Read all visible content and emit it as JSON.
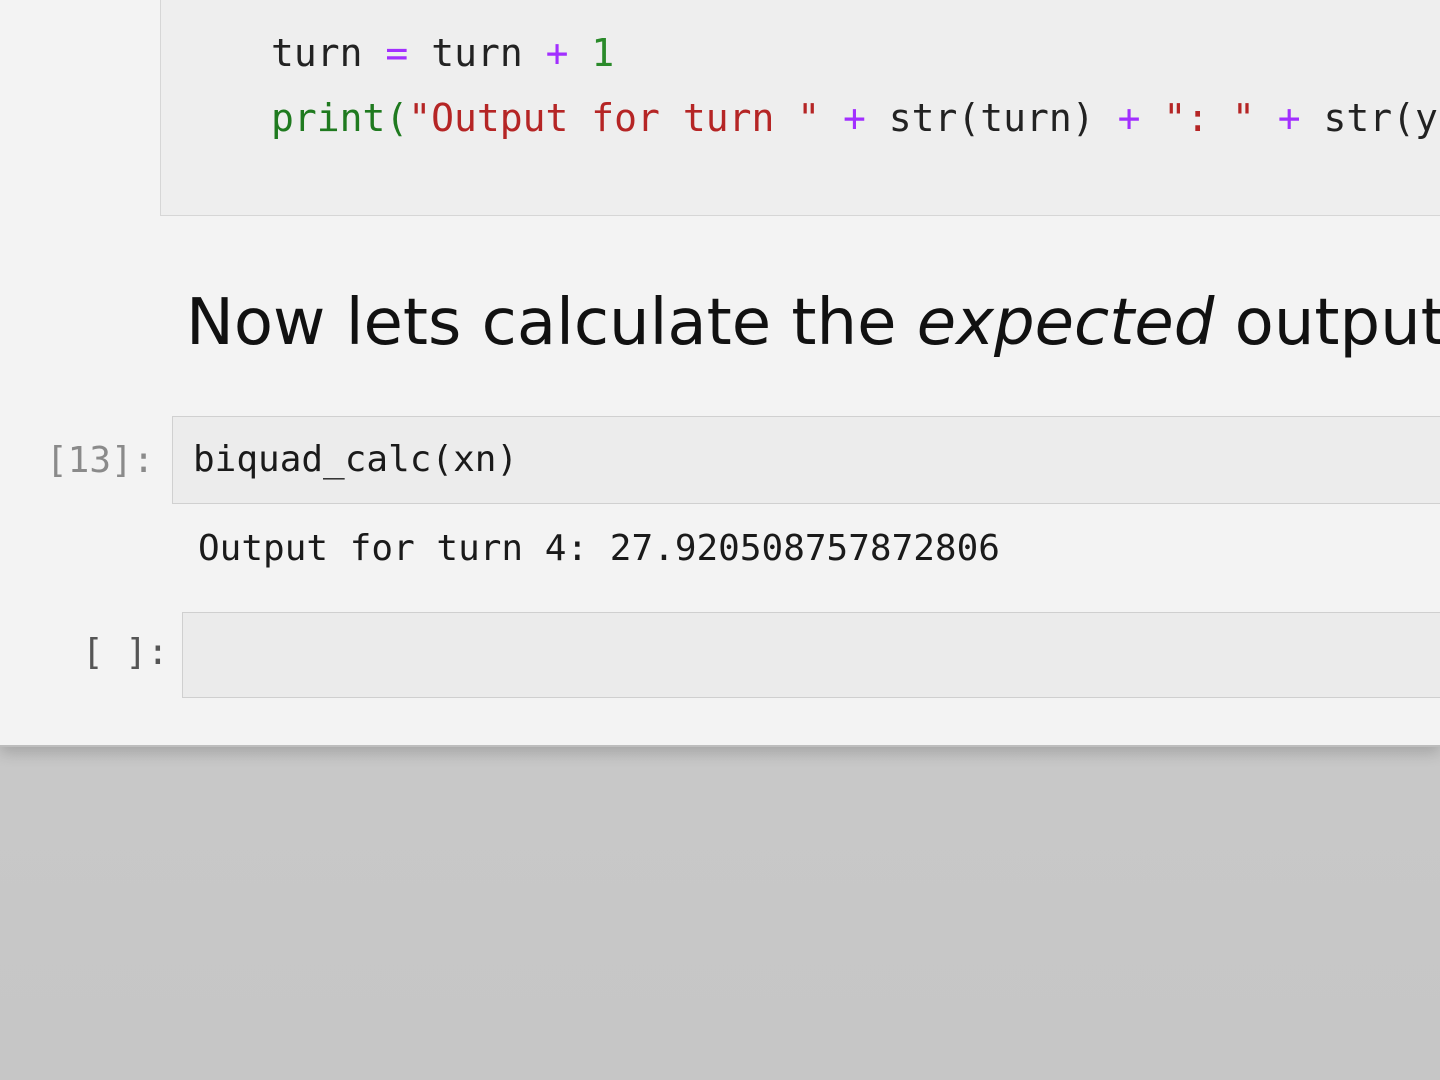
{
  "cells": {
    "previous": {
      "line1": {
        "var": "turn",
        "op": "=",
        "var2": "turn",
        "plus": "+",
        "num": "1"
      },
      "line2": {
        "print": "print(",
        "str1": "\"Output for turn \"",
        "plus1": "+",
        "call1": "str(turn)",
        "plus2": "+",
        "str2": "\": \"",
        "plus3": "+",
        "call2": "str(y"
      }
    },
    "markdown": {
      "before": "Now lets calculate the ",
      "emphasis": "expected",
      "after": " output va"
    },
    "cell13": {
      "prompt": "[13]:",
      "input": "biquad_calc(xn)",
      "output": "Output for turn 4: 27.920508757872806"
    },
    "empty_cell": {
      "prompt": "[ ]:",
      "input": ""
    }
  }
}
